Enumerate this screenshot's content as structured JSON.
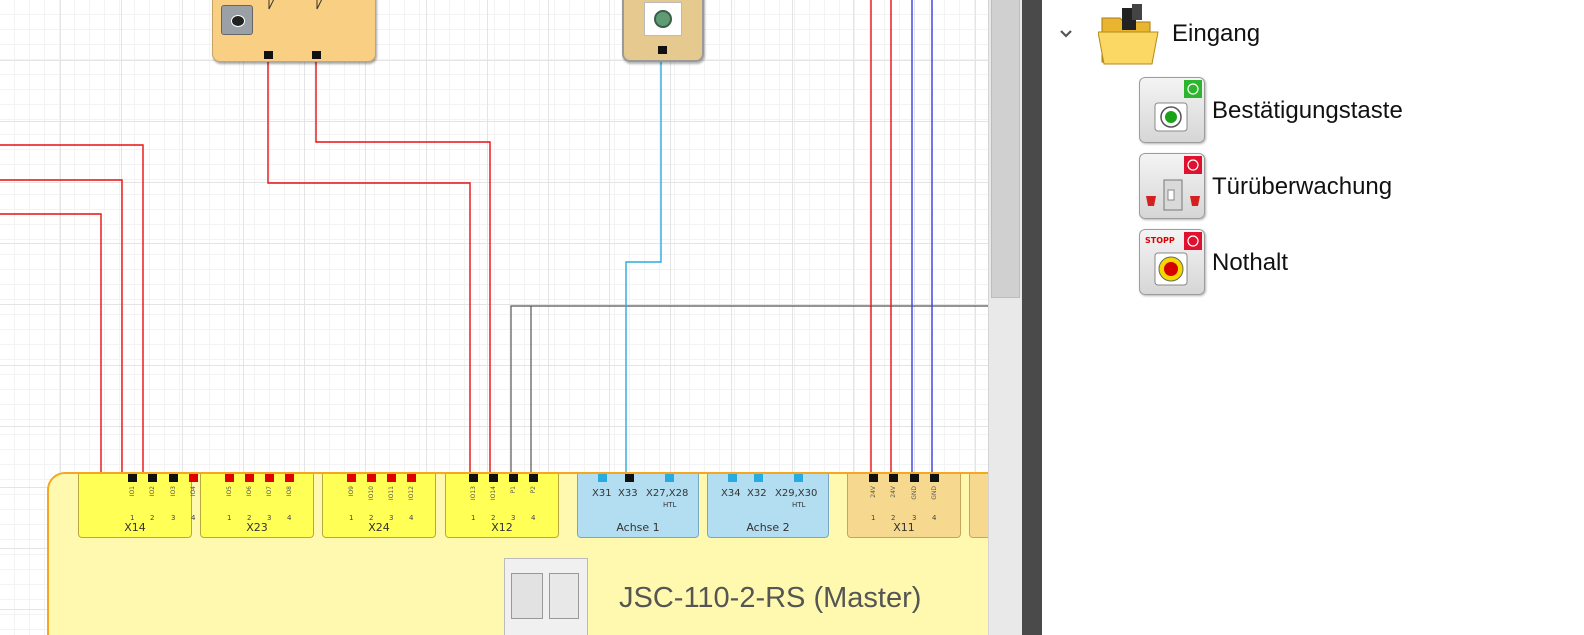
{
  "canvas": {
    "master_module": {
      "title": "JSC-110-2-RS (Master)"
    },
    "connectors": [
      {
        "name": "X14",
        "pins": [
          "IO1",
          "IO2",
          "IO3",
          "IO4"
        ],
        "numbers": [
          "1",
          "2",
          "3",
          "4"
        ]
      },
      {
        "name": "X23",
        "pins": [
          "IO5",
          "IO6",
          "IO7",
          "IO8"
        ],
        "numbers": [
          "1",
          "2",
          "3",
          "4"
        ]
      },
      {
        "name": "X24",
        "pins": [
          "IO9",
          "IO10",
          "IO11",
          "IO12"
        ],
        "numbers": [
          "1",
          "2",
          "3",
          "4"
        ]
      },
      {
        "name": "X12",
        "pins": [
          "IO13",
          "IO14",
          "P1",
          "P2"
        ],
        "numbers": [
          "1",
          "2",
          "3",
          "4"
        ]
      },
      {
        "name": "Achse 1",
        "pins": [
          "X31",
          "X33",
          "X27,X28"
        ],
        "sub": "HTL"
      },
      {
        "name": "Achse 2",
        "pins": [
          "X34",
          "X32",
          "X29,X30"
        ],
        "sub": "HTL"
      },
      {
        "name": "X11",
        "pins": [
          "24V",
          "24V",
          "GND",
          "GND"
        ],
        "numbers": [
          "1",
          "2",
          "3",
          "4"
        ]
      }
    ],
    "colors": {
      "wire_red": "#e81010",
      "wire_blue": "#3a3ae6",
      "wire_cyan": "#29aae1",
      "wire_gray": "#555555",
      "connector_yellow": "#ffff55",
      "connector_blue": "#b3def2",
      "master_background": "#fff9b0",
      "master_border": "#f5a623"
    },
    "icons": [
      "selector-switch-icon",
      "encoder-icon",
      "module-thumbnail-icon"
    ]
  },
  "tree": {
    "group": {
      "label": "Eingang",
      "icon": "folder-open-icon",
      "expanded": true
    },
    "items": [
      {
        "label": "Bestätigungstaste",
        "icon": "confirm-button-icon",
        "status_color": "#2db52d"
      },
      {
        "label": "Türüberwachung",
        "icon": "door-monitoring-icon",
        "status_color": "#e0102f"
      },
      {
        "label": "Nothalt",
        "icon": "emergency-stop-icon",
        "status_color": "#e0102f",
        "badge_text": "STOPP"
      }
    ]
  }
}
